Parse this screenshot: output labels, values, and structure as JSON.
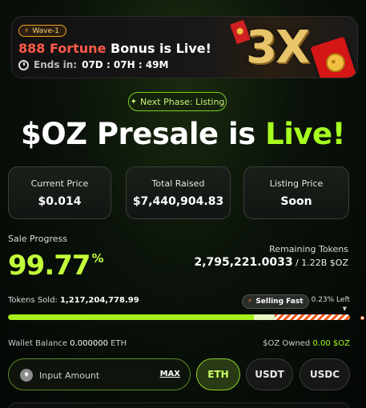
{
  "banner": {
    "wave_label": "Wave-1",
    "title_highlight": "888 Fortune",
    "title_rest": " Bonus is Live!",
    "ends_label": "Ends in:",
    "ends_value": "07D : 07H : 49M",
    "multiplier": "3X"
  },
  "next_phase": "Next Phase: Listing",
  "headline": {
    "prefix": "$OZ Presale is ",
    "highlight": "Live!"
  },
  "stats": {
    "current_price_label": "Current Price",
    "current_price_value": "$0.014",
    "total_raised_label": "Total Raised",
    "total_raised_value": "$7,440,904.83",
    "listing_price_label": "Listing Price",
    "listing_price_value": "Soon"
  },
  "progress": {
    "label": "Sale Progress",
    "percent_value": "99.77",
    "percent_sign": "%",
    "percent": 99.77,
    "remaining_label": "Remaining Tokens",
    "remaining_value": "2,795,221.0033",
    "remaining_total": " / 1.22B $OZ",
    "tokens_sold_label": "Tokens Sold: ",
    "tokens_sold_value": "1,217,204,778.99",
    "selling_fast": "Selling Fast",
    "left_label": "0.23% Left"
  },
  "wallet": {
    "balance_label": "Wallet Balance ",
    "balance_value": "0.000000",
    "balance_unit": " ETH",
    "owned_label": "$OZ Owned ",
    "owned_value": "0.00 $OZ"
  },
  "purchase": {
    "input_placeholder": "Input Amount",
    "max_label": "MAX",
    "currencies": [
      "ETH",
      "USDT",
      "USDC"
    ],
    "selected": "ETH"
  },
  "colors": {
    "accent": "#a6ff20",
    "highlight_red": "#ff5a4a",
    "gold": "#e8c46a"
  }
}
